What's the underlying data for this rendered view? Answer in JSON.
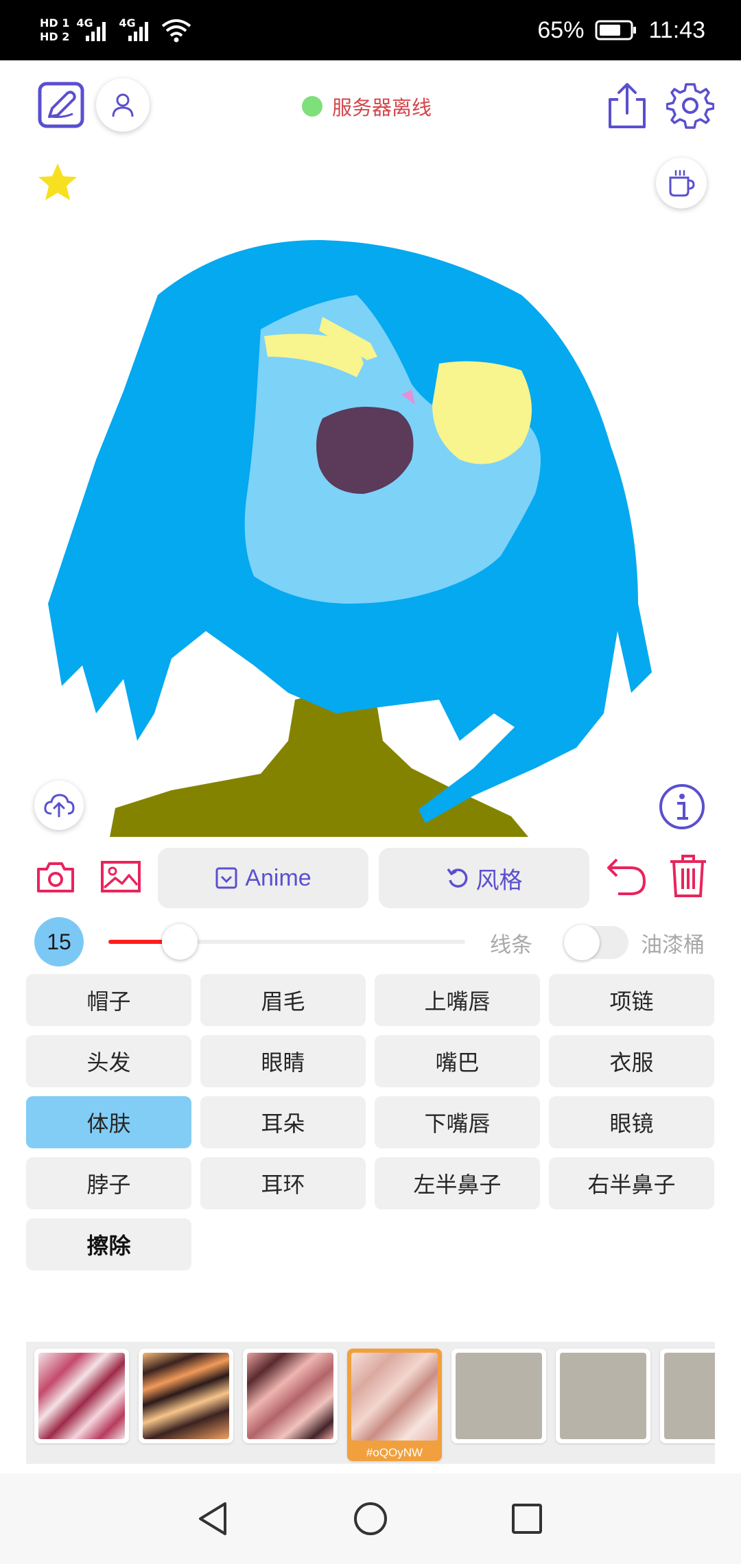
{
  "status_bar": {
    "battery_percent": "65%",
    "time": "11:43",
    "sim1": "HD 1",
    "sim2": "HD 2",
    "network1": "4G",
    "network2": "4G"
  },
  "header": {
    "server_status": "服务器离线",
    "server_status_color": "#7ee07a"
  },
  "toolbar": {
    "anime_label": "Anime",
    "style_label": "风格"
  },
  "brush": {
    "size": "15",
    "size_fraction": 0.2,
    "mode_line_label": "线条",
    "mode_bucket_label": "油漆桶",
    "bucket_enabled": false
  },
  "parts": [
    {
      "label": "帽子"
    },
    {
      "label": "眉毛"
    },
    {
      "label": "上嘴唇"
    },
    {
      "label": "项链"
    },
    {
      "label": "头发"
    },
    {
      "label": "眼睛"
    },
    {
      "label": "嘴巴"
    },
    {
      "label": "衣服"
    },
    {
      "label": "体肤"
    },
    {
      "label": "耳朵"
    },
    {
      "label": "下嘴唇"
    },
    {
      "label": "眼镜"
    },
    {
      "label": "脖子"
    },
    {
      "label": "耳环"
    },
    {
      "label": "左半鼻子"
    },
    {
      "label": "右半鼻子"
    },
    {
      "label": "擦除"
    }
  ],
  "selected_part": "体肤",
  "styles": {
    "selected_caption": "#oQOyNW"
  },
  "colors": {
    "accent": "#5a4fcf",
    "danger": "#e8245c",
    "hair": "#04a9f0",
    "skin": "#7dd2f8",
    "clothes": "#848300"
  }
}
